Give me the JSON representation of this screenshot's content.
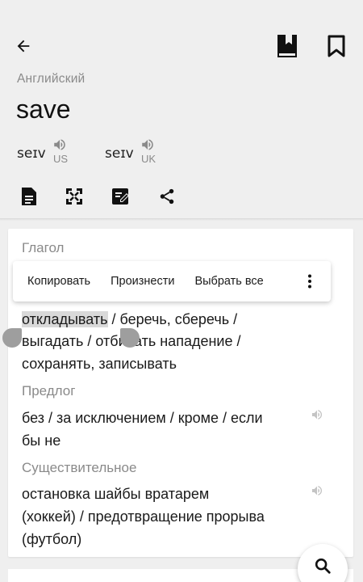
{
  "header": {
    "language": "Английский",
    "word": "save",
    "pronunciations": [
      {
        "ipa": "seɪv",
        "region": "US"
      },
      {
        "ipa": "seɪv",
        "region": "UK"
      }
    ]
  },
  "toolbar_icons": [
    "document-icon",
    "fullscreen-icon",
    "edit-note-icon",
    "share-icon"
  ],
  "context_menu": {
    "copy": "Копировать",
    "speak": "Произнести",
    "select_all": "Выбрать все"
  },
  "entries": {
    "verb": {
      "label": "Глагол",
      "line1_selected": "откладывать",
      "line1_rest": " / беречь, сберечь /",
      "line2": "выгадать / отбивать нападение /",
      "line3": "сохранять, записывать"
    },
    "preposition": {
      "label": "Предлог",
      "line1": "без / за исключением / кроме / если",
      "line2": "бы не"
    },
    "noun": {
      "label": "Существительное",
      "line1": "остановка шайбы вратарем",
      "line2": "(хоккей) / предотвращение прорыва",
      "line3": "(футбол)"
    }
  },
  "colors": {
    "background": "#efefef",
    "card": "#ffffff",
    "muted": "#8a8a8a",
    "selection": "#d9d9d9"
  }
}
